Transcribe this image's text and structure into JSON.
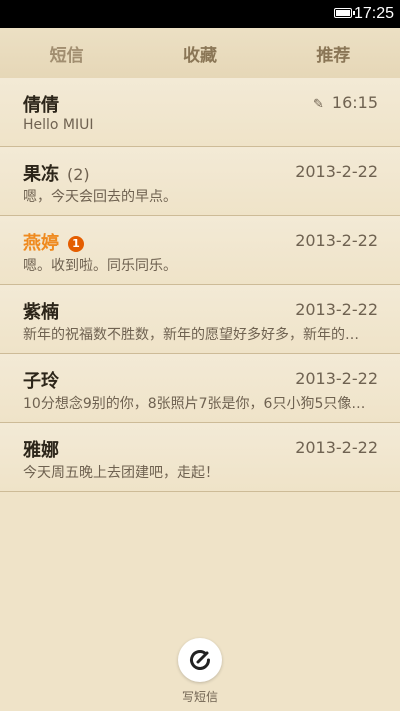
{
  "status_bar": {
    "time": "17:25"
  },
  "tabs": [
    {
      "label": "短信"
    },
    {
      "label": "收藏"
    },
    {
      "label": "推荐"
    }
  ],
  "messages": [
    {
      "name": "倩倩",
      "date": "16:15",
      "preview": "Hello MIUI",
      "draft": true
    },
    {
      "name": "果冻",
      "count": "(2)",
      "date": "2013-2-22",
      "preview": "嗯，今天会回去的早点。"
    },
    {
      "name": "燕婷",
      "badge": "1",
      "date": "2013-2-22",
      "preview": "嗯。收到啦。同乐同乐。",
      "highlight": "#ef8a1f"
    },
    {
      "name": "紫楠",
      "date": "2013-2-22",
      "preview": "新年的祝福数不胜数，新年的愿望好多好多，新年的…"
    },
    {
      "name": "子玲",
      "date": "2013-2-22",
      "preview": "10分想念9别的你，8张照片7张是你，6只小狗5只像…"
    },
    {
      "name": "雅娜",
      "date": "2013-2-22",
      "preview": "今天周五晚上去团建吧，走起！"
    }
  ],
  "compose": {
    "label": "写短信"
  }
}
